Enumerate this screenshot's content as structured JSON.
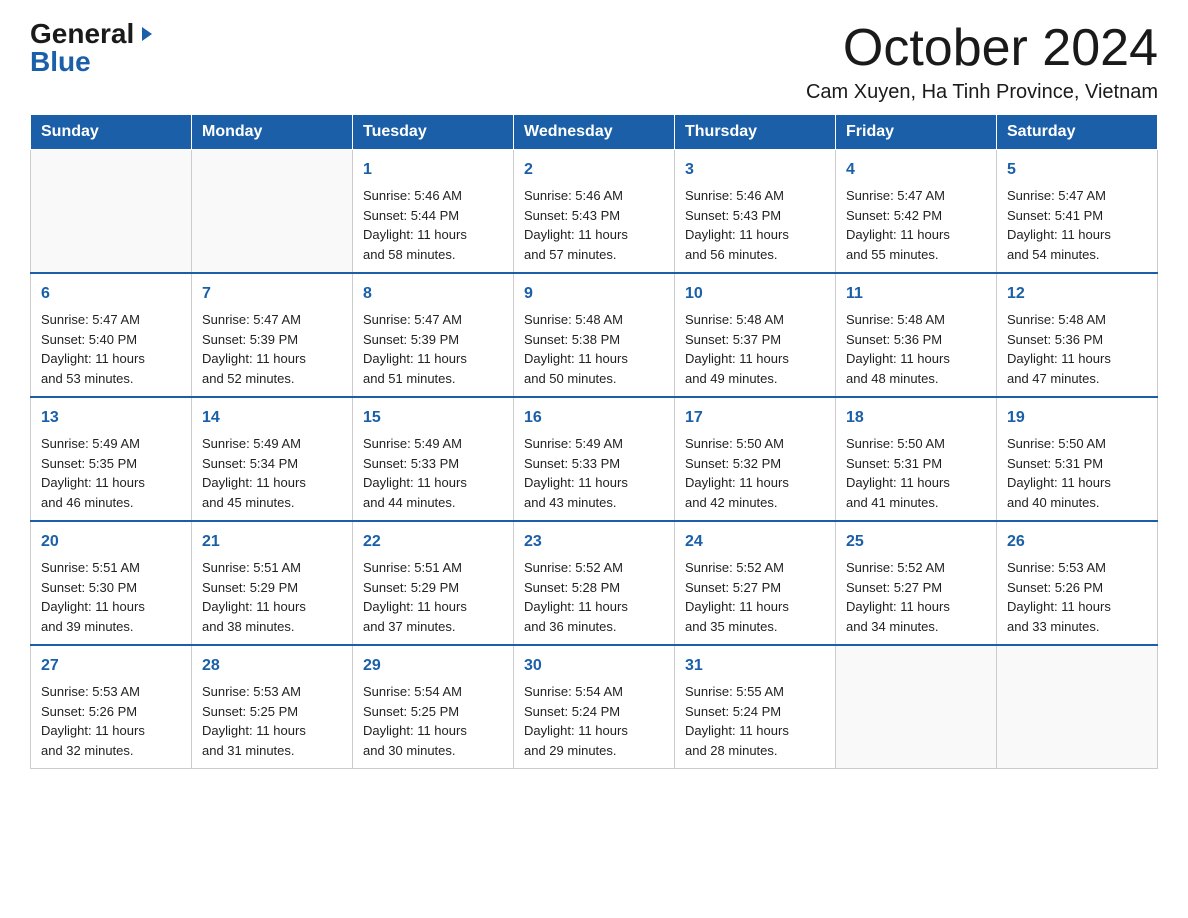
{
  "logo": {
    "general": "General",
    "arrow": "▶",
    "blue": "Blue"
  },
  "header": {
    "month": "October 2024",
    "location": "Cam Xuyen, Ha Tinh Province, Vietnam"
  },
  "days_of_week": [
    "Sunday",
    "Monday",
    "Tuesday",
    "Wednesday",
    "Thursday",
    "Friday",
    "Saturday"
  ],
  "weeks": [
    [
      {
        "day": "",
        "info": ""
      },
      {
        "day": "",
        "info": ""
      },
      {
        "day": "1",
        "info": "Sunrise: 5:46 AM\nSunset: 5:44 PM\nDaylight: 11 hours\nand 58 minutes."
      },
      {
        "day": "2",
        "info": "Sunrise: 5:46 AM\nSunset: 5:43 PM\nDaylight: 11 hours\nand 57 minutes."
      },
      {
        "day": "3",
        "info": "Sunrise: 5:46 AM\nSunset: 5:43 PM\nDaylight: 11 hours\nand 56 minutes."
      },
      {
        "day": "4",
        "info": "Sunrise: 5:47 AM\nSunset: 5:42 PM\nDaylight: 11 hours\nand 55 minutes."
      },
      {
        "day": "5",
        "info": "Sunrise: 5:47 AM\nSunset: 5:41 PM\nDaylight: 11 hours\nand 54 minutes."
      }
    ],
    [
      {
        "day": "6",
        "info": "Sunrise: 5:47 AM\nSunset: 5:40 PM\nDaylight: 11 hours\nand 53 minutes."
      },
      {
        "day": "7",
        "info": "Sunrise: 5:47 AM\nSunset: 5:39 PM\nDaylight: 11 hours\nand 52 minutes."
      },
      {
        "day": "8",
        "info": "Sunrise: 5:47 AM\nSunset: 5:39 PM\nDaylight: 11 hours\nand 51 minutes."
      },
      {
        "day": "9",
        "info": "Sunrise: 5:48 AM\nSunset: 5:38 PM\nDaylight: 11 hours\nand 50 minutes."
      },
      {
        "day": "10",
        "info": "Sunrise: 5:48 AM\nSunset: 5:37 PM\nDaylight: 11 hours\nand 49 minutes."
      },
      {
        "day": "11",
        "info": "Sunrise: 5:48 AM\nSunset: 5:36 PM\nDaylight: 11 hours\nand 48 minutes."
      },
      {
        "day": "12",
        "info": "Sunrise: 5:48 AM\nSunset: 5:36 PM\nDaylight: 11 hours\nand 47 minutes."
      }
    ],
    [
      {
        "day": "13",
        "info": "Sunrise: 5:49 AM\nSunset: 5:35 PM\nDaylight: 11 hours\nand 46 minutes."
      },
      {
        "day": "14",
        "info": "Sunrise: 5:49 AM\nSunset: 5:34 PM\nDaylight: 11 hours\nand 45 minutes."
      },
      {
        "day": "15",
        "info": "Sunrise: 5:49 AM\nSunset: 5:33 PM\nDaylight: 11 hours\nand 44 minutes."
      },
      {
        "day": "16",
        "info": "Sunrise: 5:49 AM\nSunset: 5:33 PM\nDaylight: 11 hours\nand 43 minutes."
      },
      {
        "day": "17",
        "info": "Sunrise: 5:50 AM\nSunset: 5:32 PM\nDaylight: 11 hours\nand 42 minutes."
      },
      {
        "day": "18",
        "info": "Sunrise: 5:50 AM\nSunset: 5:31 PM\nDaylight: 11 hours\nand 41 minutes."
      },
      {
        "day": "19",
        "info": "Sunrise: 5:50 AM\nSunset: 5:31 PM\nDaylight: 11 hours\nand 40 minutes."
      }
    ],
    [
      {
        "day": "20",
        "info": "Sunrise: 5:51 AM\nSunset: 5:30 PM\nDaylight: 11 hours\nand 39 minutes."
      },
      {
        "day": "21",
        "info": "Sunrise: 5:51 AM\nSunset: 5:29 PM\nDaylight: 11 hours\nand 38 minutes."
      },
      {
        "day": "22",
        "info": "Sunrise: 5:51 AM\nSunset: 5:29 PM\nDaylight: 11 hours\nand 37 minutes."
      },
      {
        "day": "23",
        "info": "Sunrise: 5:52 AM\nSunset: 5:28 PM\nDaylight: 11 hours\nand 36 minutes."
      },
      {
        "day": "24",
        "info": "Sunrise: 5:52 AM\nSunset: 5:27 PM\nDaylight: 11 hours\nand 35 minutes."
      },
      {
        "day": "25",
        "info": "Sunrise: 5:52 AM\nSunset: 5:27 PM\nDaylight: 11 hours\nand 34 minutes."
      },
      {
        "day": "26",
        "info": "Sunrise: 5:53 AM\nSunset: 5:26 PM\nDaylight: 11 hours\nand 33 minutes."
      }
    ],
    [
      {
        "day": "27",
        "info": "Sunrise: 5:53 AM\nSunset: 5:26 PM\nDaylight: 11 hours\nand 32 minutes."
      },
      {
        "day": "28",
        "info": "Sunrise: 5:53 AM\nSunset: 5:25 PM\nDaylight: 11 hours\nand 31 minutes."
      },
      {
        "day": "29",
        "info": "Sunrise: 5:54 AM\nSunset: 5:25 PM\nDaylight: 11 hours\nand 30 minutes."
      },
      {
        "day": "30",
        "info": "Sunrise: 5:54 AM\nSunset: 5:24 PM\nDaylight: 11 hours\nand 29 minutes."
      },
      {
        "day": "31",
        "info": "Sunrise: 5:55 AM\nSunset: 5:24 PM\nDaylight: 11 hours\nand 28 minutes."
      },
      {
        "day": "",
        "info": ""
      },
      {
        "day": "",
        "info": ""
      }
    ]
  ]
}
